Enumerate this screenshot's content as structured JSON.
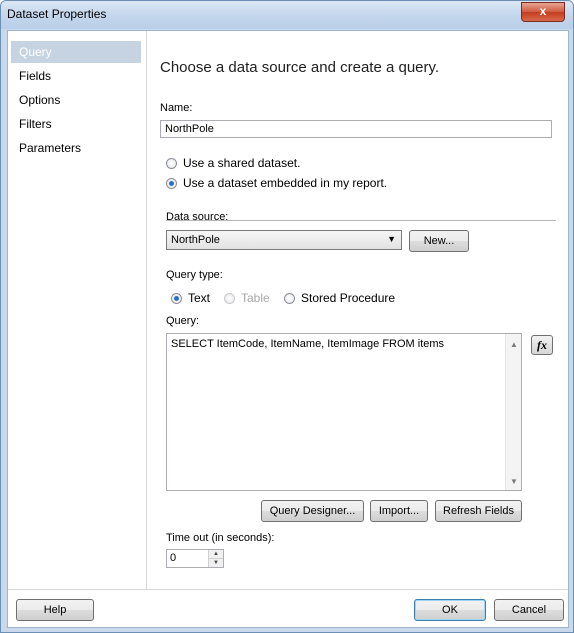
{
  "window": {
    "title": "Dataset Properties",
    "close_glyph": "x"
  },
  "nav": {
    "items": [
      "Query",
      "Fields",
      "Options",
      "Filters",
      "Parameters"
    ],
    "selected": "Query"
  },
  "heading": "Choose a data source and create a query.",
  "name_field": {
    "label": "Name:",
    "value": "NorthPole"
  },
  "dataset_options": {
    "shared": "Use a shared dataset.",
    "embedded": "Use a dataset embedded in my report.",
    "selected": "embedded"
  },
  "data_source": {
    "label": "Data source:",
    "value": "NorthPole",
    "new_button": "New..."
  },
  "query_type": {
    "label": "Query type:",
    "options": [
      "Text",
      "Table",
      "Stored Procedure"
    ],
    "selected": "Text",
    "disabled": [
      "Table"
    ]
  },
  "query": {
    "label": "Query:",
    "text": "SELECT ItemCode, ItemName, ItemImage FROM items",
    "fx_label": "fx"
  },
  "query_buttons": {
    "designer": "Query Designer...",
    "import": "Import...",
    "refresh": "Refresh Fields"
  },
  "timeout": {
    "label": "Time out (in seconds):",
    "value": "0"
  },
  "footer": {
    "help": "Help",
    "ok": "OK",
    "cancel": "Cancel"
  },
  "colors": {
    "accent": "#2b6fc7",
    "nav_selected": "#c5d3e3",
    "close_button": "#c43c1e"
  }
}
